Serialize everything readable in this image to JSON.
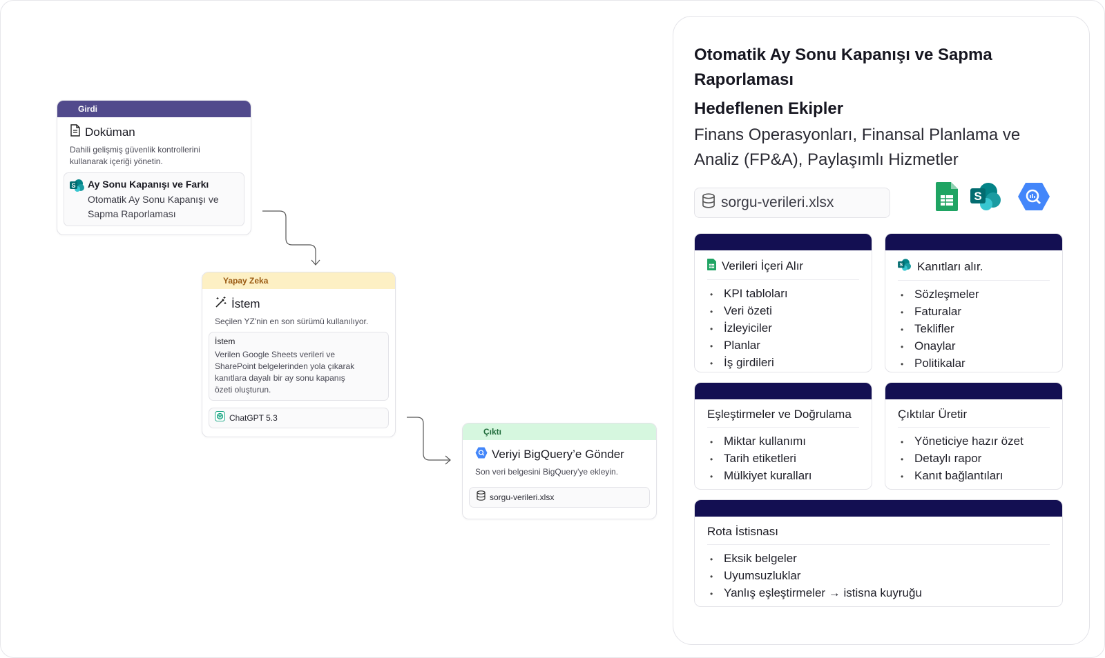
{
  "input_node": {
    "header": "Girdi",
    "title": "Doküman",
    "description": "Dahili gelişmiş güvenlik kontrollerini kullanarak içeriği yönetin.",
    "item_title": "Ay Sonu Kapanışı ve Farkı",
    "item_subtitle": "Otomatik Ay Sonu Kapanışı ve Sapma Raporlaması"
  },
  "ai_node": {
    "header": "Yapay Zeka",
    "title": "İstem",
    "description": "Seçilen YZ'nin  en son sürümü kullanılıyor.",
    "prompt_label": "İstem",
    "prompt_text": "Verilen Google Sheets verileri ve SharePoint belgelerinden yola çıkarak kanıtlara dayalı bir ay sonu kapanış özeti oluşturun.",
    "model": "ChatGPT 5.3"
  },
  "output_node": {
    "header": "Çıktı",
    "title": "Veriyi BigQuery’e Gönder",
    "description": "Son veri belgesini BigQuery'ye ekleyin.",
    "file": "sorgu-verileri.xlsx"
  },
  "panel": {
    "title": "Otomatik Ay Sonu Kapanışı ve Sapma Raporlaması",
    "subtitle": "Hedeflenen Ekipler",
    "teams": "Finans Operasyonları, Finansal Planlama ve Analiz (FP&A), Paylaşımlı Hizmetler",
    "file": "sorgu-verileri.xlsx",
    "cards": [
      {
        "title": "Verileri İçeri Alır",
        "icon": "google-sheets-icon",
        "items": [
          "KPI tabloları",
          "Veri özeti",
          "İzleyiciler",
          "Planlar",
          "İş girdileri"
        ]
      },
      {
        "title": "Kanıtları alır.",
        "icon": "sharepoint-icon",
        "items": [
          "Sözleşmeler",
          "Faturalar",
          "Teklifler",
          "Onaylar",
          "Politikalar"
        ]
      },
      {
        "title": "Eşleştirmeler ve Doğrulama",
        "items": [
          "Miktar kullanımı",
          "Tarih etiketleri",
          "Mülkiyet kuralları"
        ]
      },
      {
        "title": "Çıktılar Üretir",
        "items": [
          "Yöneticiye hazır özet",
          "Detaylı rapor",
          "Kanıt bağlantıları"
        ]
      },
      {
        "title": "Rota İstisnası",
        "items": [
          "Eksik belgeler",
          "Uyumsuzluklar",
          "Yanlış eşleştirmeler → istisna kuyruğu"
        ]
      }
    ]
  },
  "colors": {
    "input_header": "#514a8c",
    "ai_header": "#fdf0c4",
    "ai_header_text": "#9a5a12",
    "output_header": "#d6f7df",
    "output_header_text": "#1f6b3a",
    "card_bar": "#130f52",
    "sheets_green": "#1fa463",
    "sharepoint_teal": "#038387",
    "bigquery_blue": "#4386fa"
  }
}
